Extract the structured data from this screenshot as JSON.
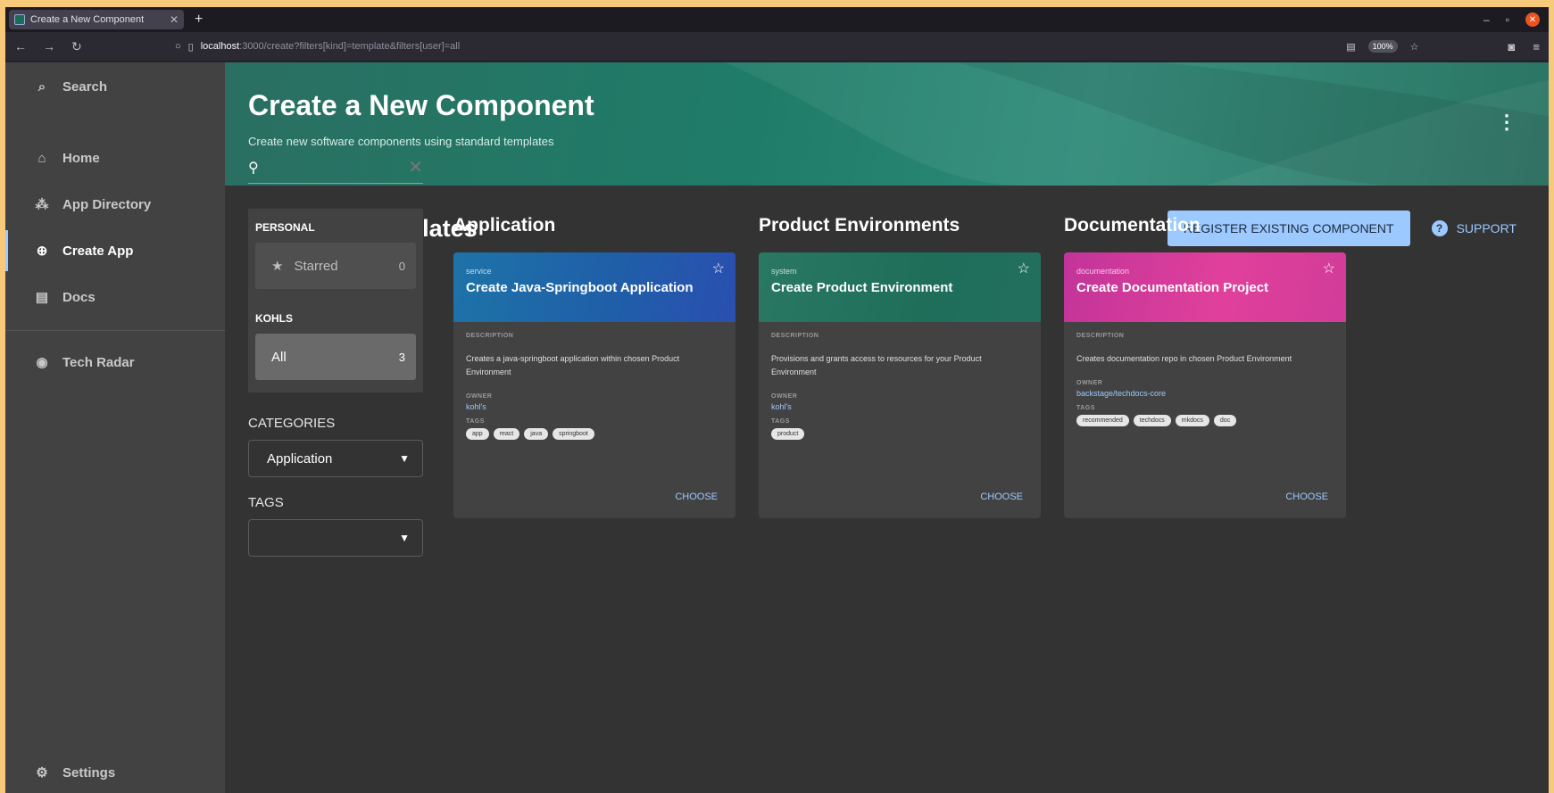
{
  "browser": {
    "tab_title": "Create a New Component",
    "url_host": "localhost",
    "url_path": ":3000/create?filters[kind]=template&filters[user]=all",
    "zoom": "100%"
  },
  "sidebar": {
    "items": [
      {
        "label": "Search",
        "icon": "search-icon"
      },
      {
        "label": "Home",
        "icon": "home-icon"
      },
      {
        "label": "App Directory",
        "icon": "directory-icon"
      },
      {
        "label": "Create App",
        "icon": "add-circle-icon"
      },
      {
        "label": "Docs",
        "icon": "docs-icon"
      },
      {
        "label": "Tech Radar",
        "icon": "radar-icon"
      }
    ],
    "settings_label": "Settings"
  },
  "header": {
    "title": "Create a New Component",
    "subtitle": "Create new software components using standard templates"
  },
  "content": {
    "title": "Available Templates",
    "register_label": "REGISTER EXISTING COMPONENT",
    "support_label": "SUPPORT"
  },
  "filters": {
    "personal_heading": "PERSONAL",
    "starred_label": "Starred",
    "starred_count": "0",
    "org_heading": "KOHLS",
    "all_label": "All",
    "all_count": "3",
    "categories_label": "CATEGORIES",
    "category_value": "Application",
    "tags_label": "TAGS",
    "tags_value": ""
  },
  "templates": [
    {
      "group": "Application",
      "kind": "service",
      "title": "Create Java-Springboot Application",
      "description_label": "DESCRIPTION",
      "description": "Creates a java-springboot application within chosen Product Environment",
      "owner_label": "OWNER",
      "owner": "kohl's",
      "tags_label": "TAGS",
      "tags": [
        "app",
        "react",
        "java",
        "springboot"
      ],
      "choose_label": "CHOOSE",
      "color": "#1f5fa8"
    },
    {
      "group": "Product Environments",
      "kind": "system",
      "title": "Create Product Environment",
      "description_label": "DESCRIPTION",
      "description": "Provisions and grants access to resources for your Product Environment",
      "owner_label": "OWNER",
      "owner": "kohl's",
      "tags_label": "TAGS",
      "tags": [
        "product"
      ],
      "choose_label": "CHOOSE",
      "color": "#1e6e5a"
    },
    {
      "group": "Documentation",
      "kind": "documentation",
      "title": "Create Documentation Project",
      "description_label": "DESCRIPTION",
      "description": "Creates documentation repo in chosen Product Environment",
      "owner_label": "OWNER",
      "owner": "backstage/techdocs-core",
      "tags_label": "TAGS",
      "tags": [
        "recommended",
        "techdocs",
        "mkdocs",
        "doc"
      ],
      "choose_label": "CHOOSE",
      "color": "#e0409b"
    }
  ]
}
